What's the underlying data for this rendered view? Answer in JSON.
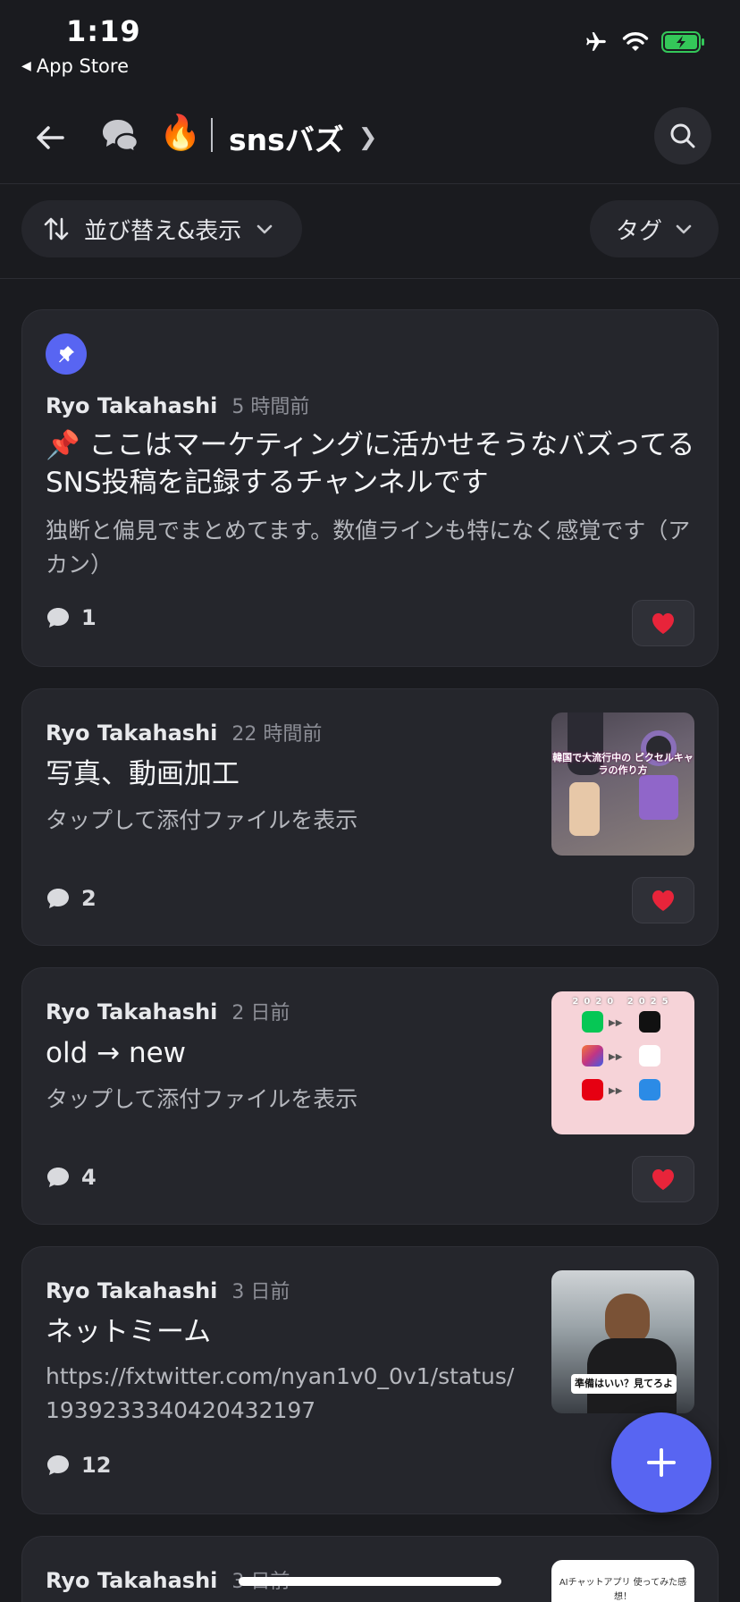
{
  "status_bar": {
    "time": "1:19",
    "back_app": "App Store"
  },
  "header": {
    "channel_name": "snsバズ",
    "emoji": "🔥"
  },
  "filters": {
    "sort_label": "並び替え&表示",
    "tag_label": "タグ"
  },
  "posts": [
    {
      "author": "Ryo Takahashi",
      "time_ago": "5 時間前",
      "title": "📌 ここはマーケティングに活かせそうなバズってるSNS投稿を記録するチャンネルです",
      "subtitle": "独断と偏見でまとめてます。数値ラインも特になく感覚です（アカン）",
      "comments": "1",
      "pinned": true
    },
    {
      "author": "Ryo Takahashi",
      "time_ago": "22 時間前",
      "title": "写真、動画加工",
      "subtitle": "タップして添付ファイルを表示",
      "comments": "2",
      "thumb_text": "韓国で大流行中の ピクセルキャラの作り方"
    },
    {
      "author": "Ryo Takahashi",
      "time_ago": "2 日前",
      "title": "old → new",
      "subtitle": "タップして添付ファイルを表示",
      "comments": "4",
      "thumb_text": "2020 2025"
    },
    {
      "author": "Ryo Takahashi",
      "time_ago": "3 日前",
      "title": "ネットミーム",
      "subtitle": "https://fxtwitter.com/nyan1v0_0v1/status/1939233340420432197",
      "comments": "12",
      "thumb_text": "準備はいい？見てろよ"
    },
    {
      "author": "Ryo Takahashi",
      "time_ago": "3 日前",
      "thumb_text": "AIチャットアプリ 使ってみた感想！"
    }
  ],
  "colors": {
    "accent": "#5865f2",
    "background": "#1a1b1f",
    "card": "#25262c"
  }
}
